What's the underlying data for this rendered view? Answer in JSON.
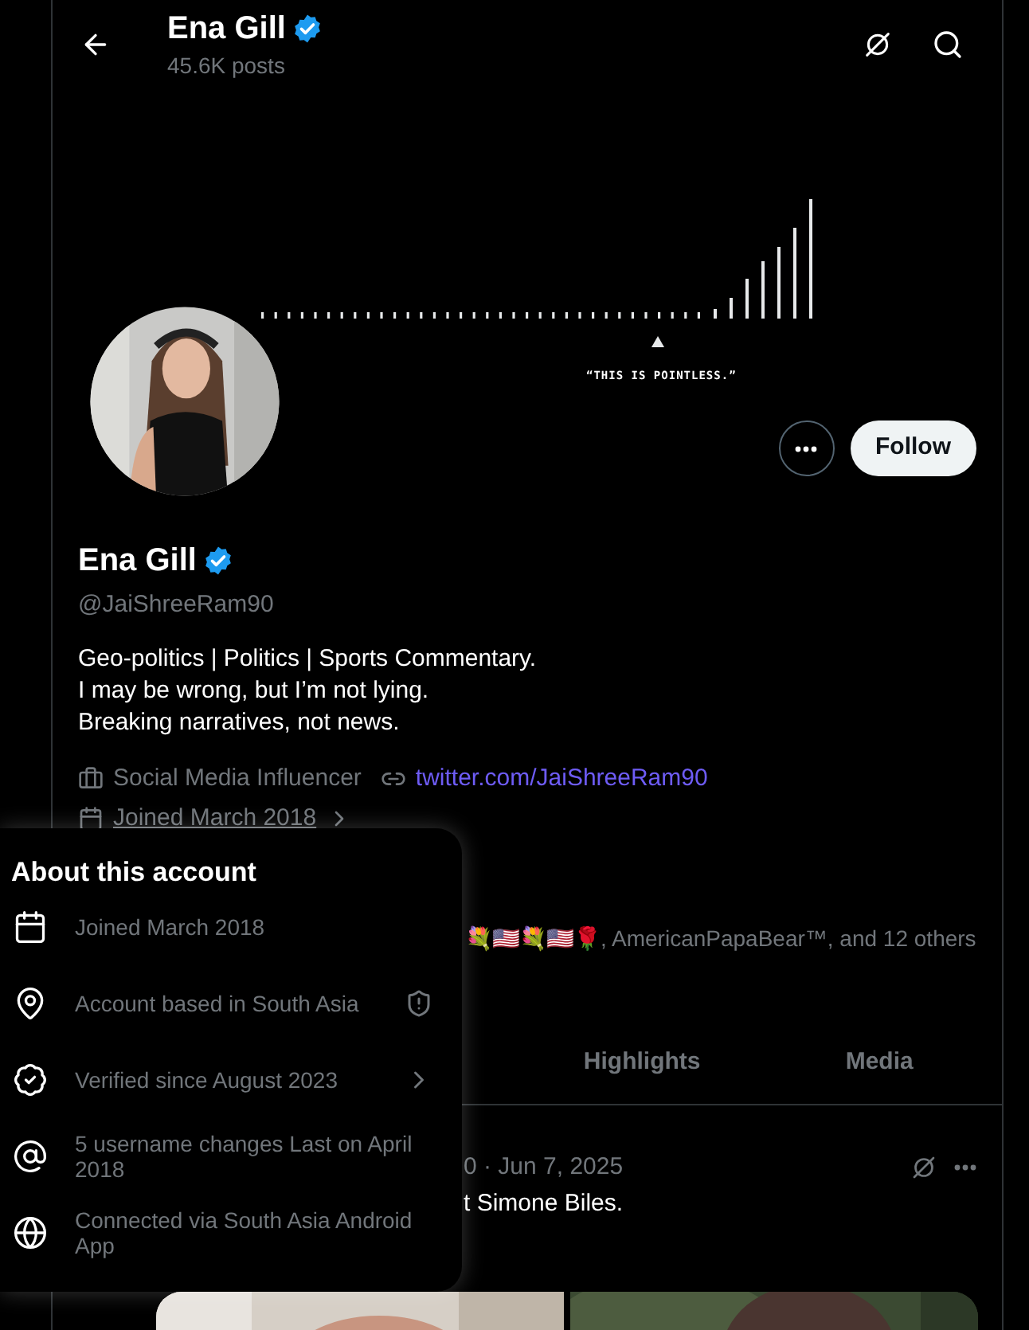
{
  "header": {
    "name": "Ena Gill",
    "verified": true,
    "posts": "45.6K posts"
  },
  "banner": {
    "caption": "“THIS IS POINTLESS.”"
  },
  "profile": {
    "follow_label": "Follow",
    "name": "Ena Gill",
    "verified": true,
    "handle": "@JaiShreeRam90",
    "bio": [
      "Geo-politics | Politics | Sports Commentary.",
      "I may be wrong, but I’m not lying.",
      "Breaking narratives, not news."
    ],
    "category": "Social Media Influencer",
    "link": "twitter.com/JaiShreeRam90",
    "joined": "Joined March 2018",
    "followed_by": "💐🇺🇸💐🇺🇸🌹, AmericanPapaBear™, and 12 others"
  },
  "tabs": [
    {
      "label": "Highlights",
      "selected": false
    },
    {
      "label": "Media",
      "selected": false
    }
  ],
  "post": {
    "meta": "0 · Jun 7, 2025",
    "text": "t Simone Biles."
  },
  "about": {
    "title": "About this account",
    "items": [
      {
        "kind": "calendar",
        "text": "Joined March 2018",
        "flagged": false,
        "expandable": false
      },
      {
        "kind": "location",
        "text": "Account based in South Asia",
        "flagged": true,
        "expandable": false
      },
      {
        "kind": "verified",
        "text": "Verified since August 2023",
        "flagged": false,
        "expandable": true
      },
      {
        "kind": "at",
        "text": "5 username changes Last on April 2018",
        "flagged": false,
        "expandable": false
      },
      {
        "kind": "globe",
        "text": "Connected via South Asia Android App",
        "flagged": false,
        "expandable": false
      }
    ]
  }
}
